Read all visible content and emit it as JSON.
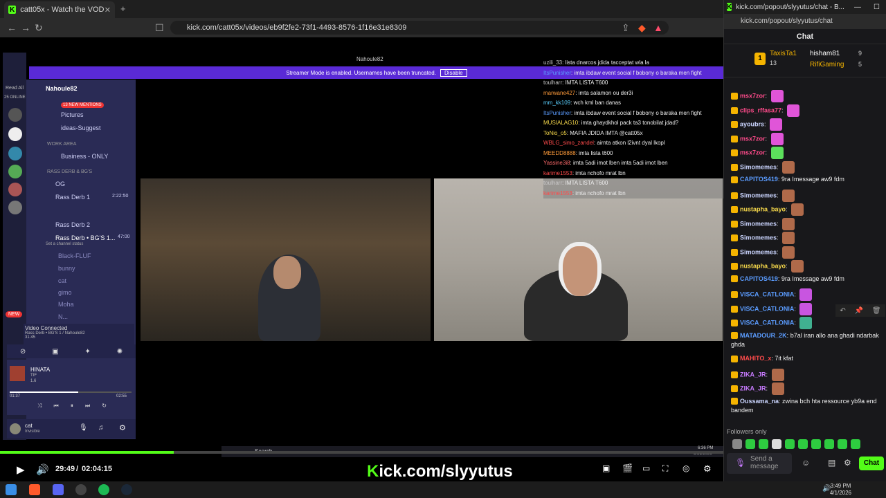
{
  "left_browser": {
    "tab_title": "catt05x - Watch the VOD on Kick",
    "url": "kick.com/catt05x/videos/eb9f2fe2-73f1-4493-8576-1f16e31e8309"
  },
  "video": {
    "window_title": "Nahoule82",
    "streamer_mode_text": "Streamer Mode is enabled. Usernames have been truncated.",
    "disable_label": "Disable",
    "discord_server": "Nahoule82",
    "mentions_badge": "13 NEW MENTIONS",
    "read_all": "Read All",
    "online_count": "25 ONLINE",
    "channels": [
      "Pictures",
      "ideas-Suggest",
      "WORK AREA",
      "Business - ONLY",
      "RASS DERB & BG'S",
      "OG",
      "Rass Derb 1",
      "Rass Derb 2",
      "Rass Derb • BG'S 1...",
      "Set a channel status"
    ],
    "voice_timer_1": "2:22:50",
    "voice_timer_2": "47:00",
    "voice_users": [
      "Black-FLUF",
      "bunny",
      "cat",
      "gimo",
      "Moha",
      "N..."
    ],
    "video_connected": "Video Connected",
    "video_connected_sub": "Rass Derb • BG'S 1 / Nahoule82",
    "call_time": "31:45",
    "music": {
      "title": "HINATA",
      "artist": "TIF",
      "album": "1.6",
      "elapsed": "01:37",
      "total": "02:55"
    },
    "user_name": "cat",
    "user_status": "Invisible",
    "new_badge": "NEW",
    "inner_search": "Search",
    "inner_time": "6:36 PM",
    "inner_date": "3/31/2026",
    "overlay_chat": [
      {
        "user": "uzili_33",
        "text": "lista dnarcos jdida tacceptat wla la",
        "color": "#c8c8c8"
      },
      {
        "user": "ItsPunisher",
        "text": "imta ibdaw event social f bobony o baraka men fight",
        "color": "#5b9cff"
      },
      {
        "user": "toulharr",
        "text": "IMTA LISTA T600",
        "color": "#c8c8c8"
      },
      {
        "user": "marwane427",
        "text": "imta salamon ou der3i",
        "color": "#ff9b3a"
      },
      {
        "user": "mm_kk109",
        "text": "wch kml ban danas",
        "color": "#5bd0ff"
      },
      {
        "user": "ItsPunisher",
        "text": "imta ibdaw event social f bobony o baraka men fight",
        "color": "#5b9cff"
      },
      {
        "user": "MUSIALAG10",
        "text": "imta ghaydkhol pack ta3 tonobilat jdad?",
        "color": "#f7d94b"
      },
      {
        "user": "ToNio_o5",
        "text": "MAFIA JDIDA IMTA @catt05x",
        "color": "#f7d94b"
      },
      {
        "user": "WBLG_simo_zandel",
        "text": "airnta atkon l2ivnt dyal lkopl",
        "color": "#ff4b4b"
      },
      {
        "user": "MEEDD8888",
        "text": "imta lista t600",
        "color": "#ff9b3a"
      },
      {
        "user": "Yassine3i8",
        "text": "imta 5adi imot lben imta 5adi imot lben",
        "color": "#ff6b6b"
      },
      {
        "user": "karime1553",
        "text": "imta nchofo mrat lbn",
        "color": "#ff4b4b"
      },
      {
        "user": "toulharr",
        "text": "IMTA LISTA T600",
        "color": "#c8c8c8"
      },
      {
        "user": "karime1553",
        "text": "imta nchofo mrat lbn",
        "color": "#ff4b4b"
      }
    ],
    "time_current": "29:49",
    "time_total": "02:04:15",
    "progress": 0.24,
    "brand_prefix": "K",
    "brand_rest": "ick.com/slyyutus"
  },
  "right_popout": {
    "tab_title": "kick.com/popout/slyyutus/chat - B...",
    "url": "kick.com/popout/slyyutus/chat",
    "header": "Chat",
    "leader": [
      {
        "rank": "1",
        "name": "TaxisTa1",
        "count": "13"
      },
      {
        "name": "hisham81",
        "count": "9"
      },
      {
        "name": "RifiGaming",
        "count": "5"
      }
    ],
    "messages": [
      {
        "user": "msx7zor",
        "text": "",
        "color": "#ff4b8b",
        "emote": true
      },
      {
        "user": "clips_rffasa77",
        "text": "",
        "color": "#ff4b8b",
        "emote": true
      },
      {
        "user": "ayoubrs",
        "text": "",
        "color": "#cbd5ff",
        "emote": true
      },
      {
        "user": "msx7zor",
        "text": "",
        "color": "#ff4b8b",
        "emote": true
      },
      {
        "user": "msx7zor",
        "text": "",
        "color": "#ff4b8b",
        "emote": true
      },
      {
        "user": "Simomemes",
        "text": "",
        "color": "#cbd5ff",
        "emote": true
      },
      {
        "user": "CAPITOS419",
        "text": "9ra Imessage aw9 fdm",
        "color": "#5b9cff",
        "emote": false
      },
      {
        "user": "Simomemes",
        "text": "",
        "color": "#cbd5ff",
        "emote": true
      },
      {
        "user": "nustapha_bayo",
        "text": "",
        "color": "#f7d94b",
        "emote": true
      },
      {
        "user": "Simomemes",
        "text": "",
        "color": "#cbd5ff",
        "emote": true
      },
      {
        "user": "Simomemes",
        "text": "",
        "color": "#cbd5ff",
        "emote": true
      },
      {
        "user": "Simomemes",
        "text": "",
        "color": "#cbd5ff",
        "emote": true
      },
      {
        "user": "nustapha_bayo",
        "text": "",
        "color": "#f7d94b",
        "emote": true
      },
      {
        "user": "CAPITOS419",
        "text": "9ra Imessage aw9 fdm",
        "color": "#5b9cff",
        "emote": false
      },
      {
        "user": "VISCA_CATLONIA",
        "text": "",
        "color": "#5b9cff",
        "emote": true
      },
      {
        "user": "VISCA_CATLONIA",
        "text": "",
        "color": "#5b9cff",
        "emote": true
      },
      {
        "user": "VISCA_CATLONIA",
        "text": "",
        "color": "#5b9cff",
        "emote": true
      },
      {
        "user": "MATADOUR_2K",
        "text": "b7al iran allo ana ghadi ndarbak ghda",
        "color": "#5b9cff",
        "emote": false
      },
      {
        "user": "MAHITO_x",
        "text": "7it kfat",
        "color": "#ff4b4b",
        "emote": false
      },
      {
        "user": "ZIKA_JR",
        "text": "",
        "color": "#c87bff",
        "emote": true
      },
      {
        "user": "ZIKA_JR",
        "text": "",
        "color": "#c87bff",
        "emote": true
      },
      {
        "user": "Oussama_na",
        "text": "zwina bch hta ressource yb9a end bandem",
        "color": "#cbd5ff",
        "emote": false
      }
    ],
    "followers_only": "Followers only",
    "send_placeholder": "Send a message",
    "chat_button": "Chat"
  },
  "taskbar": {
    "time": "3:49 PM",
    "date": "4/1/2026"
  },
  "colors": {
    "kick_green": "#53fc18",
    "discord_purple": "#5a2ad6"
  }
}
